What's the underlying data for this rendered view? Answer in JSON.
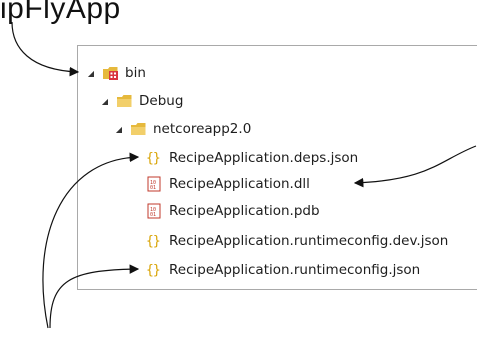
{
  "callout": {
    "text": "ipFlyApp"
  },
  "tree": {
    "items": [
      {
        "label": "bin"
      },
      {
        "label": "Debug"
      },
      {
        "label": "netcoreapp2.0"
      },
      {
        "label": "RecipeApplication.deps.json"
      },
      {
        "label": "RecipeApplication.dll"
      },
      {
        "label": "RecipeApplication.pdb"
      },
      {
        "label": "RecipeApplication.runtimeconfig.dev.json"
      },
      {
        "label": "RecipeApplication.runtimeconfig.json"
      }
    ]
  },
  "colors": {
    "folder": "#e6b93c",
    "bin_icon": "#d9363e",
    "json_braces": "#d8a200",
    "binary_icon": "#c0392b",
    "border": "#a9a9a9"
  }
}
